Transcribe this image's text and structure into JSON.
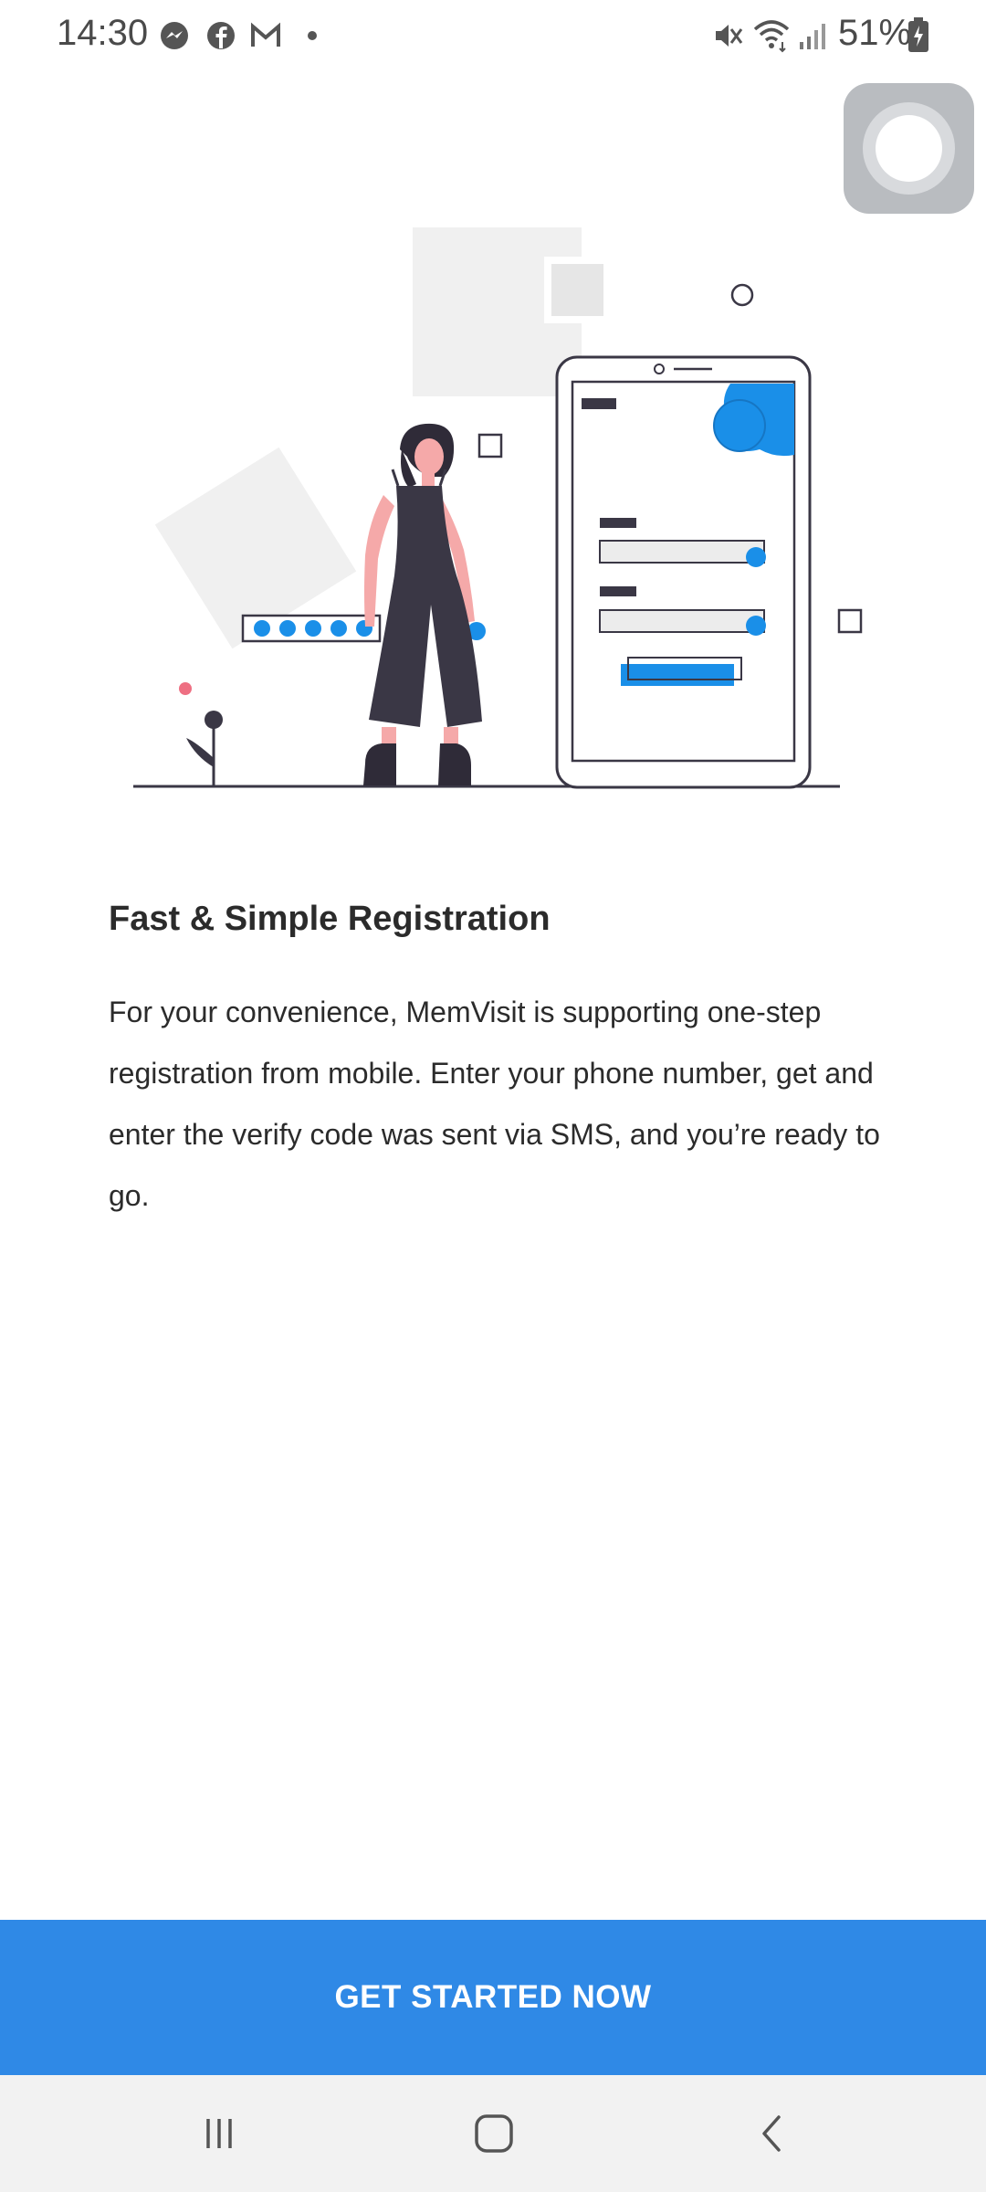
{
  "status_bar": {
    "time": "14:30",
    "battery": "51%",
    "icons": [
      "messenger-icon",
      "facebook-icon",
      "gmail-icon",
      "dot-icon",
      "mute-icon",
      "wifi-icon",
      "signal-icon",
      "battery-icon"
    ]
  },
  "onboarding": {
    "title": "Fast & Simple Registration",
    "description": "For your convenience, MemVisit is supporting one-step registration from mobile. Enter your phone number, get and enter the verify code was sent via SMS, and you’re ready to go."
  },
  "cta": {
    "label": "GET STARTED NOW"
  },
  "colors": {
    "accent": "#2f89e6",
    "illustration_blue": "#1a8fe8",
    "illustration_dark": "#3a3745"
  },
  "nav_bar": {
    "buttons": [
      "recents-icon",
      "home-icon",
      "back-icon"
    ]
  }
}
